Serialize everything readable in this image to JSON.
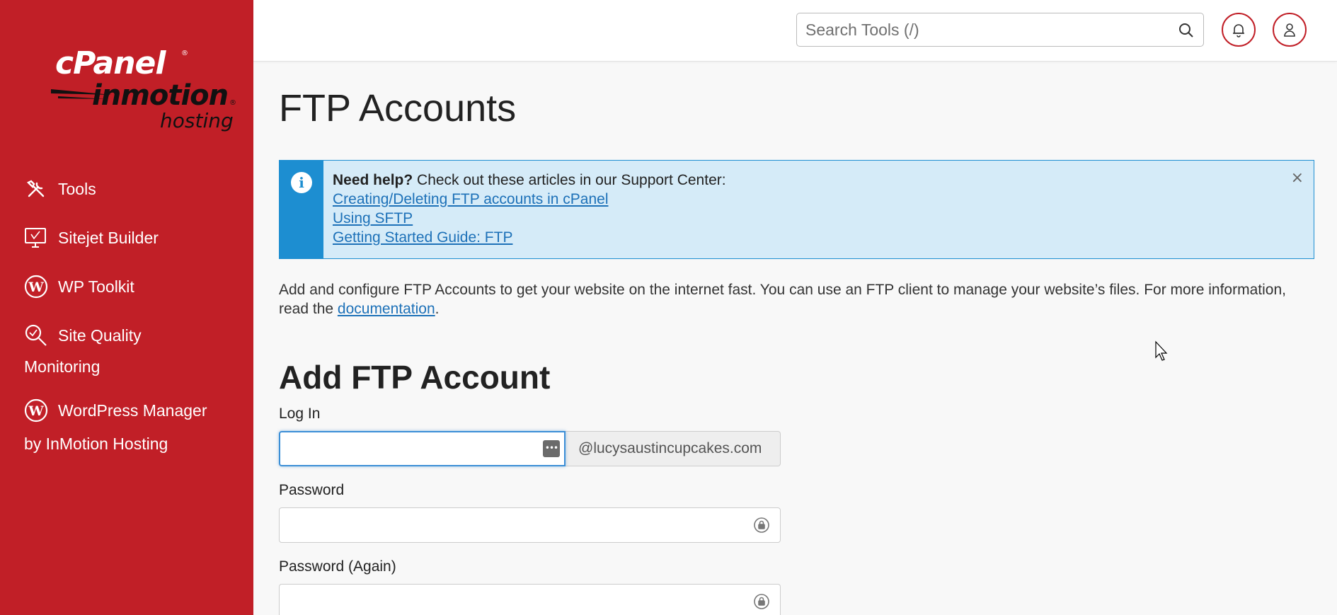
{
  "sidebar": {
    "logo": {
      "cpanel": "cPanel",
      "inmotion": "inmotion",
      "hosting": "hosting",
      "reg": "®"
    },
    "items": [
      {
        "label": "Tools",
        "icon": "tools-icon"
      },
      {
        "label": "Sitejet Builder",
        "icon": "monitor-icon"
      },
      {
        "label": "WP Toolkit",
        "icon": "wordpress-icon"
      },
      {
        "label_line1": "Site Quality",
        "label_line2": "Monitoring",
        "icon": "magnifier-check-icon"
      },
      {
        "label_line1": "WordPress Manager",
        "label_line2": "by InMotion Hosting",
        "icon": "wordpress-icon"
      }
    ]
  },
  "header": {
    "search_placeholder": "Search Tools (/)",
    "notifications_icon": "bell-icon",
    "user_icon": "user-icon"
  },
  "main": {
    "title": "FTP Accounts",
    "alert": {
      "bold": "Need help?",
      "text": " Check out these articles in our Support Center:",
      "links": [
        "Creating/Deleting FTP accounts in cPanel",
        "Using SFTP",
        "Getting Started Guide: FTP"
      ],
      "close": "×"
    },
    "description": {
      "before": "Add and configure FTP Accounts to get your website on the internet fast. You can use an FTP client to manage your website’s files. For more information, read the ",
      "link": "documentation",
      "after": "."
    },
    "form": {
      "title": "Add FTP Account",
      "login_label": "Log In",
      "login_value": "",
      "domain_suffix": "@lucysaustincupcakes.com",
      "password_label": "Password",
      "password_again_label": "Password (Again)"
    }
  },
  "colors": {
    "sidebar": "#c11f27",
    "alert_bg": "#d5ebf8",
    "alert_accent": "#1d8ed1",
    "link": "#1d71b8"
  }
}
